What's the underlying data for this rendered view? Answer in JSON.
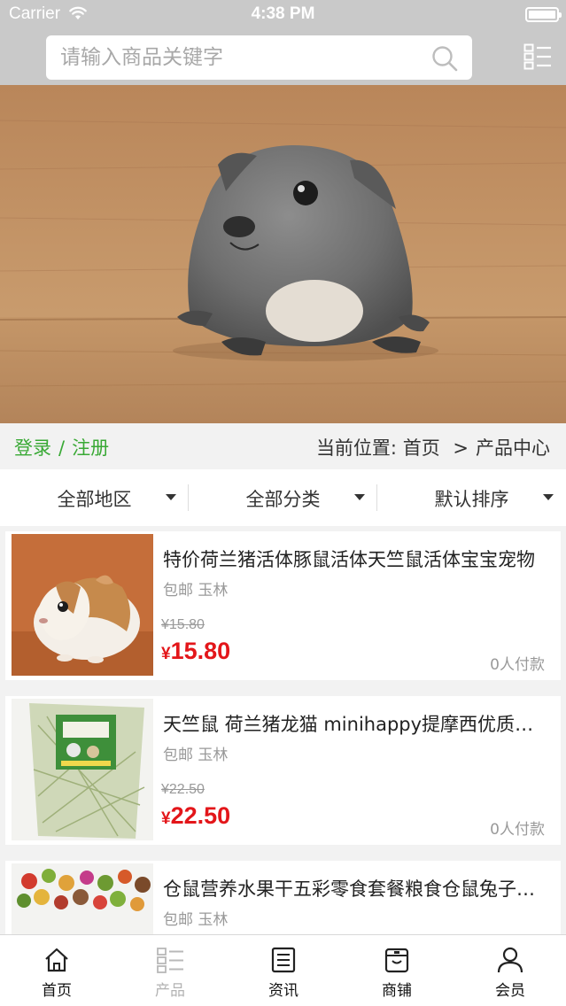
{
  "status_bar": {
    "carrier": "Carrier",
    "time": "4:38 PM"
  },
  "search": {
    "placeholder": "请输入商品关键字"
  },
  "auth": {
    "login": "登录",
    "separator": "/",
    "register": "注册"
  },
  "breadcrumb": {
    "prefix": "当前位置:",
    "home": "首页",
    "separator": ">",
    "current": "产品中心"
  },
  "filters": [
    {
      "label": "全部地区"
    },
    {
      "label": "全部分类"
    },
    {
      "label": "默认排序"
    }
  ],
  "products": [
    {
      "title": "特价荷兰猪活体豚鼠活体天竺鼠活体宝宝宠物",
      "location": "包邮 玉林",
      "old_price": "¥15.80",
      "currency": "¥",
      "price": "15.80",
      "paid": "0人付款",
      "image": "guinea-pig-photo"
    },
    {
      "title": "天竺鼠 荷兰猪龙猫 minihappy提摩西优质牧草",
      "location": "包邮 玉林",
      "old_price": "¥22.50",
      "currency": "¥",
      "price": "22.50",
      "paid": "0人付款",
      "image": "hay-bag-photo"
    },
    {
      "title": "仓鼠营养水果干五彩零食套餐粮食仓鼠兔子饲料",
      "location": "包邮 玉林",
      "old_price": "",
      "currency": "",
      "price": "",
      "paid": "",
      "image": "pellet-food-photo"
    }
  ],
  "tabs": [
    {
      "label": "首页",
      "icon": "home-icon",
      "active": true
    },
    {
      "label": "产品",
      "icon": "grid-list-icon",
      "active": false
    },
    {
      "label": "资讯",
      "icon": "news-icon",
      "active": true
    },
    {
      "label": "商铺",
      "icon": "store-icon",
      "active": true
    },
    {
      "label": "会员",
      "icon": "user-icon",
      "active": true
    }
  ],
  "colors": {
    "accent_green": "#39a935",
    "price_red": "#e3161a",
    "header_gray": "#c9c9c9"
  }
}
